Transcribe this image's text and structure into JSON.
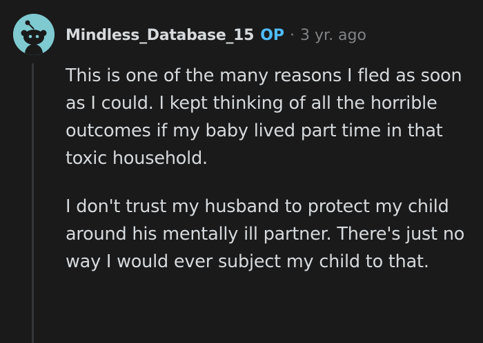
{
  "comment": {
    "author": "Mindless_Database_15",
    "op_badge": "OP",
    "separator": "·",
    "timestamp": "3 yr. ago",
    "paragraphs": [
      "This is one of the many reasons I fled as soon as I could. I kept thinking of all the horrible outcomes if my baby lived part time in that toxic household.",
      "I don't trust my husband to protect my child around his mentally ill partner. There's just no way I would ever subject my child to that."
    ]
  },
  "colors": {
    "background": "#1a1a1b",
    "text": "#d7dadc",
    "op_badge": "#4fbcff",
    "meta": "#818384",
    "avatar_bg": "#7ecad0",
    "thread_line": "#343536"
  },
  "icons": {
    "avatar": "snoo-avatar-icon"
  }
}
